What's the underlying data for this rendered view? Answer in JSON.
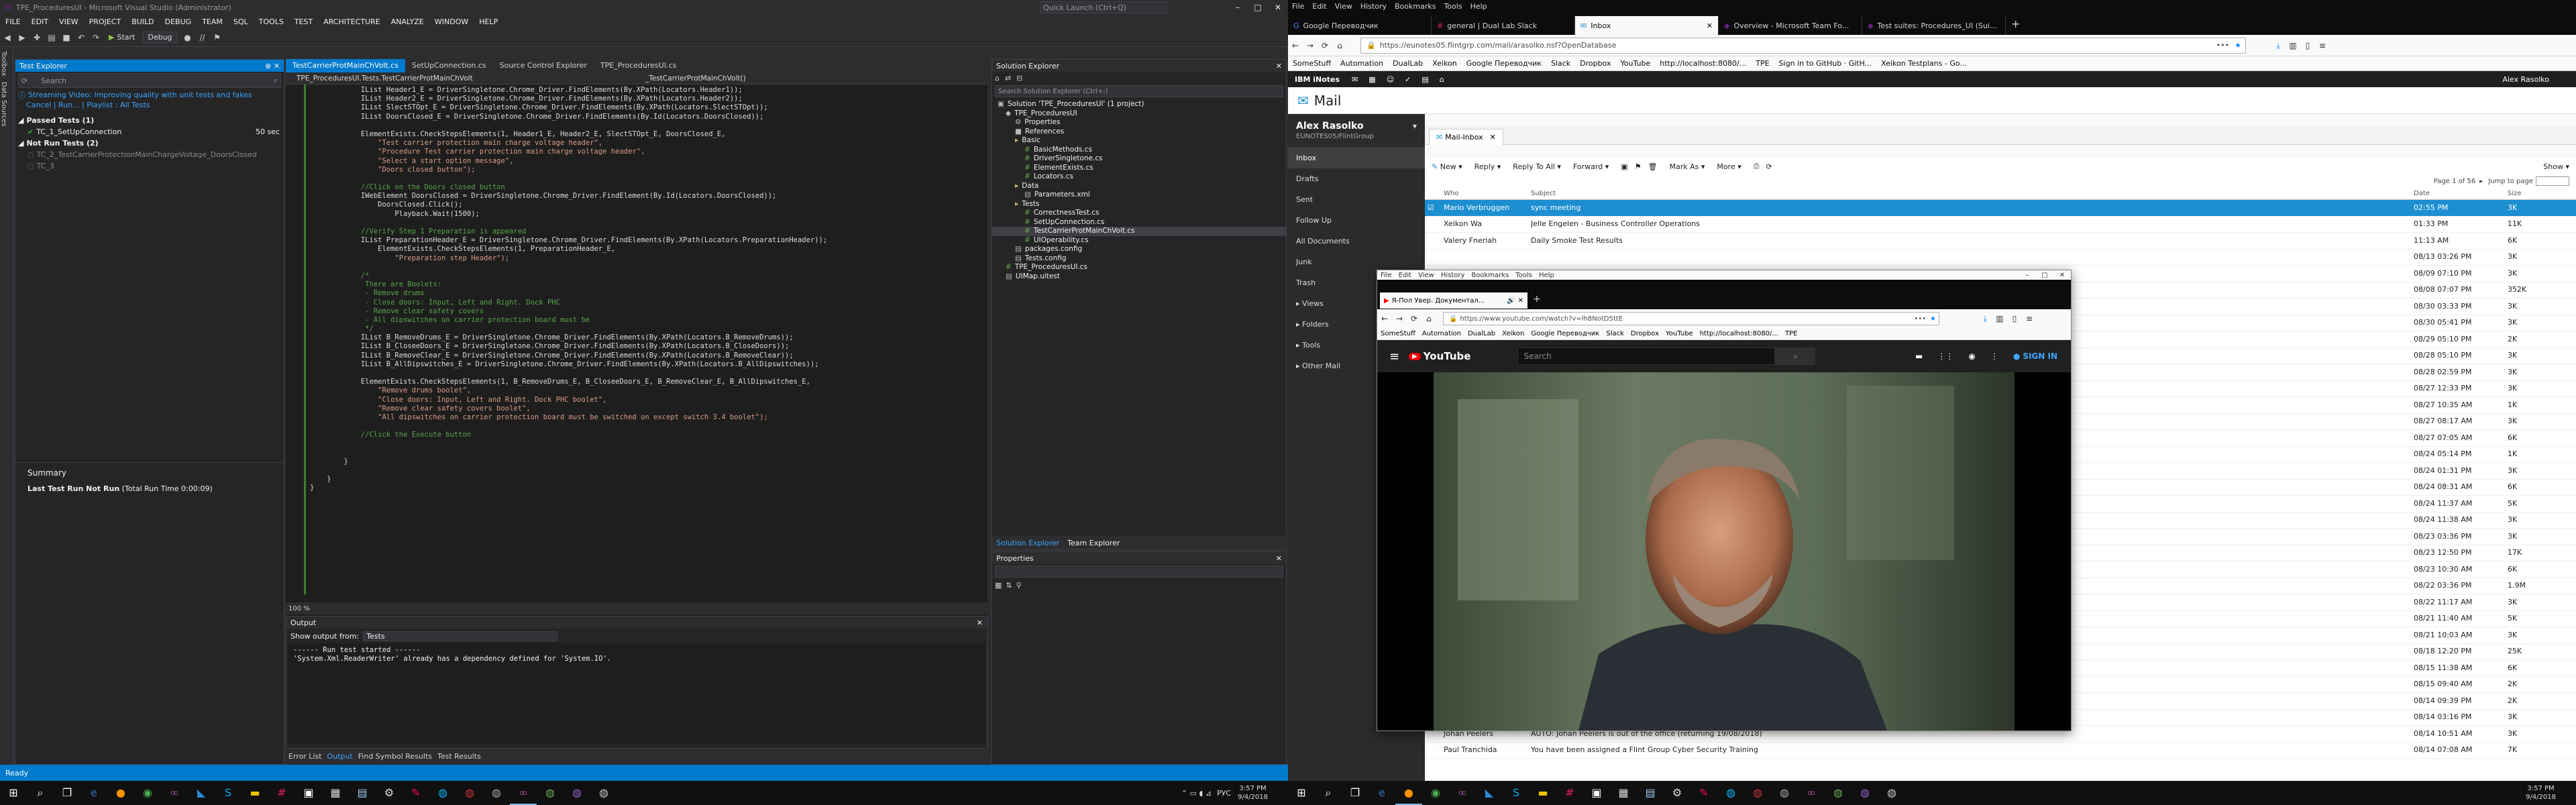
{
  "vs": {
    "title": "TPE_ProceduresUI - Microsoft Visual Studio (Administrator)",
    "quick_launch": "Quick Launch (Ctrl+Q)",
    "menu": [
      "FILE",
      "EDIT",
      "VIEW",
      "PROJECT",
      "BUILD",
      "DEBUG",
      "TEAM",
      "SQL",
      "TOOLS",
      "TEST",
      "ARCHITECTURE",
      "ANALYZE",
      "WINDOW",
      "HELP"
    ],
    "toolbar": {
      "start_label": "Start",
      "config": "Debug"
    },
    "side_tabs": [
      "Toolbox",
      "Data Sources"
    ],
    "test_explorer": {
      "title": "Test Explorer",
      "search_placeholder": "Search",
      "notice": "Streaming Video: Improving quality with unit tests and fakes",
      "actions": "Cancel | Run... | Playlist : All Tests",
      "passed_header": "Passed Tests (1)",
      "passed_test": "TC_1_SetUpConnection",
      "passed_time": "50 sec",
      "not_run_header": "Not Run Tests (2)",
      "not_run_1": "TC_2_TestCarrierProtectionMainChargeVoltage_DoorsClosed",
      "not_run_2": "TC_3",
      "summary_title": "Summary",
      "summary_text": "Last Test Run Not Run",
      "summary_time": "(Total Run Time 0:00:09)"
    },
    "editor": {
      "tabs": [
        "TestCarrierProtMainChVolt.cs",
        "SetUpConnection.cs",
        "Source Control Explorer",
        "TPE_ProceduresUI.cs"
      ],
      "nav_left": "TPE_ProceduresUI.Tests.TestCarrierProtMainChVolt",
      "nav_right": "_TestCarrierProtMainChVolt()",
      "zoom": "100 %",
      "lines": [
        "            IList Header1_E = DriverSingletone.Chrome_Driver.FindElements(By.XPath(Locators.Header1));",
        "            IList Header2_E = DriverSingletone.Chrome_Driver.FindElements(By.XPath(Locators.Header2));",
        "            IList SlectSTOpt_E = DriverSingletone.Chrome_Driver.FindElements(By.XPath(Locators.SlectSTOpt));",
        "            IList DoorsClosed_E = DriverSingletone.Chrome_Driver.FindElements(By.Id(Locators.DoorsClosed));",
        "",
        "            ElementExists.CheckStepsElements(1, Header1_E, Header2_E, SlectSTOpt_E, DoorsClosed_E,",
        "                \"Test carrier protection main charge voltage header\",",
        "                \"Procedure Test carrier protection main charge voltage header\",",
        "                \"Select a start option message\",",
        "                \"Doors closed button\");",
        "",
        "            //Click on the Doors closed button",
        "            IWebElement DoorsClosed = DriverSingletone.Chrome_Driver.FindElement(By.Id(Locators.DoorsClosed));",
        "                DoorsClosed.Click();",
        "                    Playback.Wait(1500);",
        "",
        "            //Verify Step 1 Preparation is appeared",
        "            IList PreparationHeader_E = DriverSingletone.Chrome_Driver.FindElements(By.XPath(Locators.PreparationHeader));",
        "                ElementExists.CheckStepsElements(1, PreparationHeader_E,",
        "                    \"Preparation step Header\");",
        "",
        "            /*",
        "             There are Boolets:",
        "             - Remove drums",
        "             - Close doors: Input, Left and Right. Dock PHC",
        "             - Remove clear safety covers",
        "             - All dipswitches on carrier protection board must be",
        "             */",
        "            IList B_RemoveDrums_E = DriverSingletone.Chrome_Driver.FindElements(By.XPath(Locators.B_RemoveDrums));",
        "            IList B_CloseeDoors_E = DriverSingletone.Chrome_Driver.FindElements(By.XPath(Locators.B_CloseDoors));",
        "            IList B_RemoveClear_E = DriverSingletone.Chrome_Driver.FindElements(By.XPath(Locators.B_RemoveClear));",
        "            IList B_AllDipswitches_E = DriverSingletone.Chrome_Driver.FindElements(By.XPath(Locators.B_AllDipswitches));",
        "",
        "            ElementExists.CheckStepsElements(1, B_RemoveDrums_E, B_CloseeDoors_E, B_RemoveClear_E, B_AllDipswitches_E,",
        "                \"Remove drums boolet\",",
        "                \"Close doors: Input, Left and Right. Dock PHC boolet\",",
        "                \"Remove clear safety covers boolet\",",
        "                \"All dipswitches on carrier protection board must be switched on except switch 3.4 boolet\");",
        "",
        "            //Click the Execute button",
        "",
        "",
        "        }",
        "",
        "    }",
        "}"
      ]
    },
    "output": {
      "title": "Output",
      "show_from_label": "Show output from:",
      "show_from_value": "Tests",
      "line1": "------ Run test started ------",
      "line2": "'System.Xml.ReaderWriter' already has a dependency defined for 'System.IO'."
    },
    "bottom_tabs": [
      "Error List",
      "Output",
      "Find Symbol Results",
      "Test Results"
    ],
    "solution_explorer": {
      "title": "Solution Explorer",
      "search_placeholder": "Search Solution Explorer (Ctrl+;)",
      "items": [
        "Solution 'TPE_ProceduresUI' (1 project)",
        "TPE_ProceduresUI",
        "Properties",
        "References",
        "Basic",
        "BasicMethods.cs",
        "DriverSingletone.cs",
        "ElementExists.cs",
        "Locators.cs",
        "Data",
        "Parameters.xml",
        "Tests",
        "CorrectnessTest.cs",
        "SetUpConnection.cs",
        "TestCarrierProtMainChVolt.cs",
        "UIOperability.cs",
        "packages.config",
        "Tests.config",
        "TPE_ProceduresUI.cs",
        "UIMap.uitest"
      ],
      "footer_tabs": [
        "Solution Explorer",
        "Team Explorer"
      ]
    },
    "properties": {
      "title": "Properties"
    },
    "status": "Ready"
  },
  "firefox": {
    "menu": [
      "File",
      "Edit",
      "View",
      "History",
      "Bookmarks",
      "Tools",
      "Help"
    ],
    "tabs": [
      "Google Переводчик",
      "general | Dual Lab Slack",
      "Inbox",
      "Overview - Microsoft Team Fo...",
      "Test suites: Procedures_UI (Suite..."
    ],
    "url": "https://eunotes05.flintgrp.com/mail/arasolko.nsf?OpenDatabase",
    "bookmarks": [
      "SomeStuff",
      "Automation",
      "DualLab",
      "Xeikon",
      "Google Переводчик",
      "Slack",
      "Dropbox",
      "YouTube",
      "http://localhost:8080/...",
      "TPE",
      "Sign in to GitHub · GitH...",
      "Xeikon Testplans - Go..."
    ]
  },
  "notes": {
    "brand": "IBM iNotes",
    "user_top": "Alex Rasolko",
    "app_title": "Mail",
    "tab": "Mail-Inbox",
    "user_name": "Alex Rasolko",
    "user_org": "EUNOTES05/FlintGroup",
    "nav": [
      "Inbox",
      "Drafts",
      "Sent",
      "Follow Up",
      "All Documents",
      "Junk",
      "Trash",
      "Views",
      "Folders",
      "Tools",
      "Other Mail"
    ],
    "toolbar": [
      "New",
      "Reply",
      "Reply To All",
      "Forward",
      "Mark As",
      "More"
    ],
    "show": "Show",
    "paging": "Page 1 of 56",
    "jump": "Jump to page",
    "columns": {
      "who": "Who",
      "subject": "Subject",
      "date": "Date",
      "size": "Size"
    },
    "rows": [
      {
        "who": "Mario Verbruggen",
        "subject": "sync meeting",
        "date": "02:55 PM",
        "size": "3K"
      },
      {
        "who": "Xeikon Wa",
        "subject": "Jelle Engelen - Business Controller Operations",
        "date": "01:33 PM",
        "size": "11K"
      },
      {
        "who": "Valery Fneriah",
        "subject": "Daily Smoke Test Results",
        "date": "11:13 AM",
        "size": "6K"
      },
      {
        "who": "",
        "subject": "",
        "date": "08/13 03:26 PM",
        "size": "3K"
      },
      {
        "who": "",
        "subject": "",
        "date": "08/09 07:10 PM",
        "size": "3K"
      },
      {
        "who": "",
        "subject": "",
        "date": "08/08 07:07 PM",
        "size": "352K"
      },
      {
        "who": "",
        "subject": "",
        "date": "08/30 03:33 PM",
        "size": "3K"
      },
      {
        "who": "",
        "subject": "",
        "date": "08/30 05:41 PM",
        "size": "3K"
      },
      {
        "who": "",
        "subject": "",
        "date": "08/29 05:10 PM",
        "size": "2K"
      },
      {
        "who": "",
        "subject": "",
        "date": "08/28 05:10 PM",
        "size": "3K"
      },
      {
        "who": "",
        "subject": "",
        "date": "08/28 02:59 PM",
        "size": "3K"
      },
      {
        "who": "",
        "subject": "",
        "date": "08/27 12:33 PM",
        "size": "3K"
      },
      {
        "who": "",
        "subject": "",
        "date": "08/27 10:35 AM",
        "size": "1K"
      },
      {
        "who": "",
        "subject": "",
        "date": "08/27 08:17 AM",
        "size": "3K"
      },
      {
        "who": "",
        "subject": "",
        "date": "08/27 07:05 AM",
        "size": "6K"
      },
      {
        "who": "",
        "subject": "",
        "date": "08/24 05:14 PM",
        "size": "1K"
      },
      {
        "who": "",
        "subject": "",
        "date": "08/24 01:31 PM",
        "size": "3K"
      },
      {
        "who": "",
        "subject": "",
        "date": "08/24 08:31 AM",
        "size": "6K"
      },
      {
        "who": "",
        "subject": "",
        "date": "08/24 11:37 AM",
        "size": "5K"
      },
      {
        "who": "",
        "subject": "",
        "date": "08/24 11:38 AM",
        "size": "3K"
      },
      {
        "who": "",
        "subject": "",
        "date": "08/23 03:36 PM",
        "size": "3K"
      },
      {
        "who": "",
        "subject": "",
        "date": "08/23 12:50 PM",
        "size": "17K"
      },
      {
        "who": "",
        "subject": "",
        "date": "08/23 10:30 AM",
        "size": "6K"
      },
      {
        "who": "",
        "subject": "",
        "date": "08/22 03:36 PM",
        "size": "1.9M"
      },
      {
        "who": "",
        "subject": "",
        "date": "08/22 11:17 AM",
        "size": "3K"
      },
      {
        "who": "",
        "subject": "",
        "date": "08/21 11:40 AM",
        "size": "5K"
      },
      {
        "who": "",
        "subject": "",
        "date": "08/21 10:03 AM",
        "size": "3K"
      },
      {
        "who": "",
        "subject": "",
        "date": "08/18 12:20 PM",
        "size": "25K"
      },
      {
        "who": "",
        "subject": "",
        "date": "08/15 11:38 AM",
        "size": "6K"
      },
      {
        "who": "",
        "subject": "",
        "date": "08/15 09:40 AM",
        "size": "2K"
      },
      {
        "who": "",
        "subject": "",
        "date": "08/14 09:39 PM",
        "size": "2K"
      },
      {
        "who": "",
        "subject": "",
        "date": "08/14 03:16 PM",
        "size": "3K"
      },
      {
        "who": "Johan Peelers",
        "subject": "AUTO: Johan Peelers is out of the office (returning 19/08/2018)",
        "date": "08/14 10:51 AM",
        "size": "3K"
      },
      {
        "who": "Paul Tranchida",
        "subject": "You have been assigned a Flint Group Cyber Security Training",
        "date": "08/14 07:08 AM",
        "size": "7K"
      }
    ]
  },
  "youtube_window": {
    "menu": [
      "File",
      "Edit",
      "View",
      "History",
      "Bookmarks",
      "Tools",
      "Help"
    ],
    "tab": "Я-Пол Увер. Документал...",
    "url": "https://www.youtube.com/watch?v=lh8NotD5ttE",
    "bookmarks": [
      "SomeStuff",
      "Automation",
      "DualLab",
      "Xeikon",
      "Google Переводчик",
      "Slack",
      "Dropbox",
      "YouTube",
      "http://localhost:8080/...",
      "TPE"
    ],
    "logo": "YouTube",
    "search_placeholder": "Search",
    "sign_in": "SIGN IN"
  },
  "taskbar": {
    "lang": "РУС",
    "time_left": "3:57 PM",
    "date_left": "9/4/2018",
    "time_right": "3:57 PM",
    "date_right": "9/4/2018"
  }
}
